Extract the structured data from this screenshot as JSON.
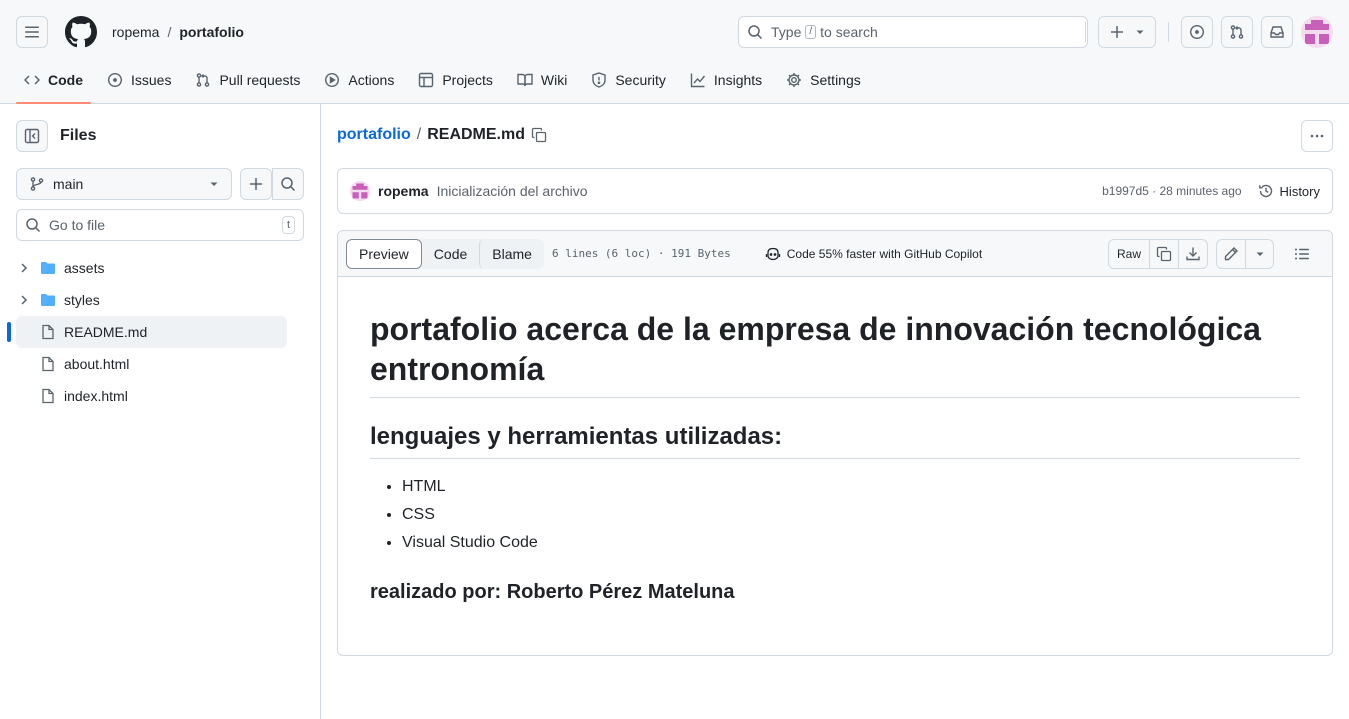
{
  "header": {
    "owner": "ropema",
    "separator": "/",
    "repo": "portafolio",
    "search_placeholder_prefix": "Type",
    "search_kbd": "/",
    "search_placeholder_suffix": "to search",
    "nav": [
      {
        "label": "Code",
        "icon": "code-icon",
        "active": true
      },
      {
        "label": "Issues",
        "icon": "issue-icon"
      },
      {
        "label": "Pull requests",
        "icon": "pull-request-icon"
      },
      {
        "label": "Actions",
        "icon": "play-icon"
      },
      {
        "label": "Projects",
        "icon": "table-icon"
      },
      {
        "label": "Wiki",
        "icon": "book-icon"
      },
      {
        "label": "Security",
        "icon": "shield-icon"
      },
      {
        "label": "Insights",
        "icon": "graph-icon"
      },
      {
        "label": "Settings",
        "icon": "gear-icon"
      }
    ]
  },
  "sidebar": {
    "title": "Files",
    "branch": "main",
    "goto_placeholder": "Go to file",
    "goto_kbd": "t",
    "tree": [
      {
        "name": "assets",
        "type": "folder"
      },
      {
        "name": "styles",
        "type": "folder"
      },
      {
        "name": "README.md",
        "type": "file",
        "selected": true
      },
      {
        "name": "about.html",
        "type": "file"
      },
      {
        "name": "index.html",
        "type": "file"
      }
    ]
  },
  "main": {
    "path_repo": "portafolio",
    "path_sep": "/",
    "path_file": "README.md",
    "commit": {
      "author": "ropema",
      "message": "Inicialización del archivo",
      "sha_time": "b1997d5 · 28 minutes ago",
      "history_label": "History"
    },
    "file_header": {
      "tabs": [
        "Preview",
        "Code",
        "Blame"
      ],
      "active_tab": "Preview",
      "meta": "6 lines (6 loc) · 191 Bytes",
      "copilot": "Code 55% faster with GitHub Copilot",
      "raw_label": "Raw"
    },
    "readme": {
      "h1": "portafolio acerca de la empresa de innovación tecnológica entronomía",
      "h2": "lenguajes y herramientas utilizadas:",
      "list": [
        "HTML",
        "CSS",
        "Visual Studio Code"
      ],
      "h3": "realizado por: Roberto Pérez Mateluna"
    }
  },
  "colors": {
    "accent": "#0969da",
    "active_underline": "#fd8c73",
    "border": "#d1d9e0",
    "header_bg": "#f6f8fa"
  }
}
